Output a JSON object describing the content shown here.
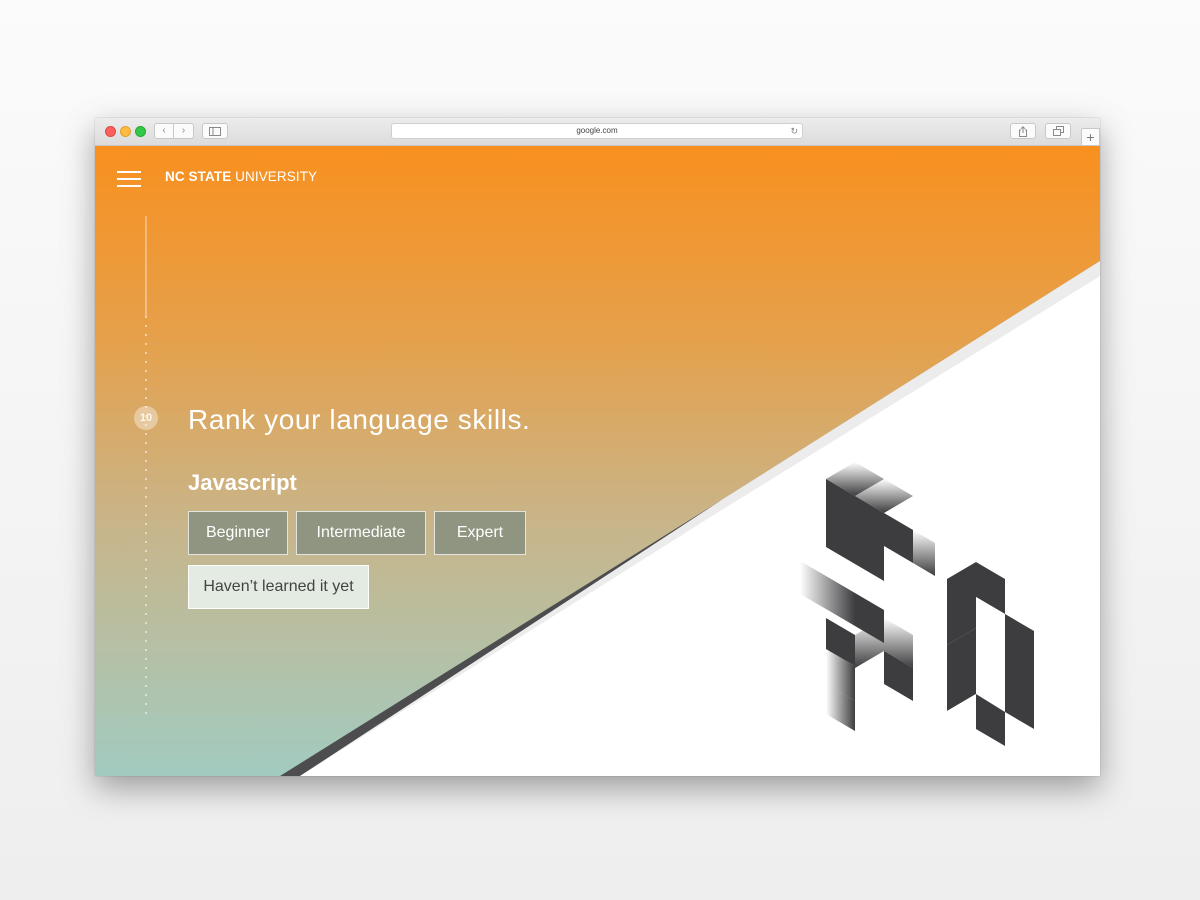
{
  "browser": {
    "url": "google.com",
    "icons": {
      "back": "chevron-left-icon",
      "forward": "chevron-right-icon",
      "sidebar": "sidebar-icon",
      "reload": "reload-icon",
      "share": "share-icon",
      "tabs": "tabs-icon",
      "new_tab": "plus-icon"
    }
  },
  "header": {
    "brand_bold": "NC STATE",
    "brand_light": " UNIVERSITY",
    "menu_icon": "hamburger-menu-icon"
  },
  "progress": {
    "step_number": "10"
  },
  "question": {
    "title": "Rank your language skills.",
    "language": "Javascript",
    "options": [
      "Beginner",
      "Intermediate",
      "Expert",
      "Haven’t learned it yet"
    ],
    "selected_option": "Haven’t learned it yet"
  },
  "colors": {
    "gradient_top": "#f8901f",
    "gradient_bottom": "#a2cbc0",
    "dark_stripe": "#4d4d4f",
    "light_stripe": "#ececec",
    "pixel_art": "#3d3d3f"
  }
}
